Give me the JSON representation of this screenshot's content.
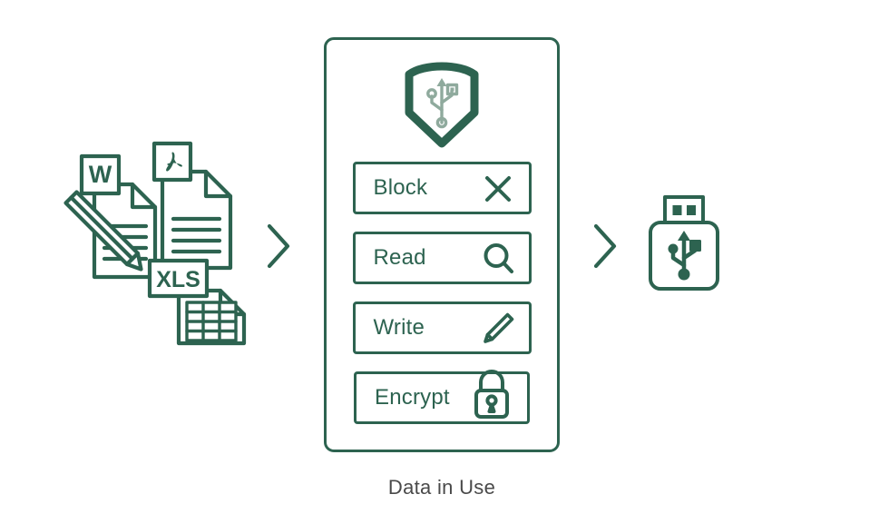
{
  "diagram": {
    "caption": "Data in Use",
    "colors": {
      "primary_green": "#2d6350",
      "muted_green": "#8faa9d",
      "caption_gray": "#4a4a4a",
      "background": "#ffffff"
    }
  },
  "source_documents": {
    "items": [
      {
        "id": "word",
        "badge_label": "W",
        "icon_name": "word-document-icon"
      },
      {
        "id": "pdf",
        "badge_label": "",
        "icon_name": "pdf-document-icon"
      },
      {
        "id": "xls",
        "badge_label": "XLS",
        "icon_name": "xls-spreadsheet-icon"
      }
    ],
    "pencil_icon_name": "pencil-icon"
  },
  "flow": {
    "arrow_left_icon": "chevron-right-icon",
    "arrow_right_icon": "chevron-right-icon"
  },
  "panel": {
    "shield_icon_name": "usb-shield-icon",
    "actions": [
      {
        "label": "Block",
        "icon": "close-x-icon"
      },
      {
        "label": "Read",
        "icon": "magnifier-icon"
      },
      {
        "label": "Write",
        "icon": "pencil-icon"
      },
      {
        "label": "Encrypt",
        "icon": "lock-icon"
      }
    ]
  },
  "destination": {
    "label": "",
    "icon_name": "usb-drive-icon"
  }
}
